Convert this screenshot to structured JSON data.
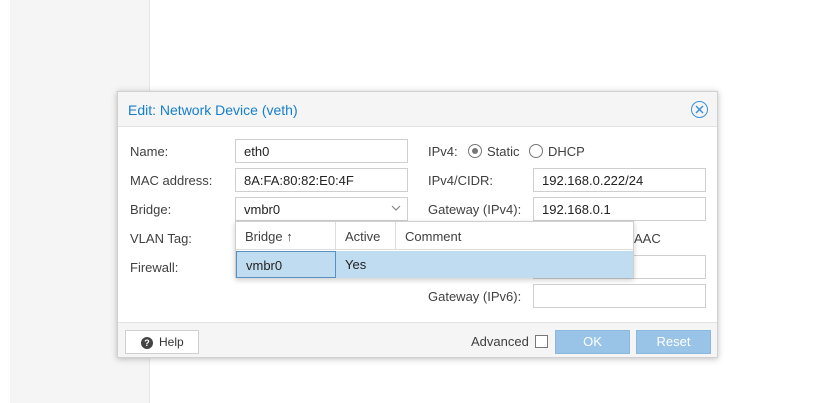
{
  "dialog": {
    "title": "Edit: Network Device (veth)",
    "close_icon": "close-circle-icon"
  },
  "form": {
    "name_label": "Name:",
    "name_value": "eth0",
    "mac_label": "MAC address:",
    "mac_value": "8A:FA:80:82:E0:4F",
    "bridge_label": "Bridge:",
    "bridge_value": "vmbr0",
    "vlan_label": "VLAN Tag:",
    "firewall_label": "Firewall:",
    "ipv4_label": "IPv4:",
    "ipv4_static_label": "Static",
    "ipv4_dhcp_label": "DHCP",
    "ipv4_selected": "Static",
    "ipv4cidr_label": "IPv4/CIDR:",
    "ipv4cidr_value": "192.168.0.222/24",
    "gateway4_label": "Gateway (IPv4):",
    "gateway4_value": "192.168.0.1",
    "ipv6_partial_label": "AAC",
    "ipv6cidr_value": "",
    "gateway6_label": "Gateway (IPv6):",
    "gateway6_value": ""
  },
  "bridge_dropdown": {
    "columns": [
      "Bridge ↑",
      "Active",
      "Comment"
    ],
    "rows": [
      {
        "bridge": "vmbr0",
        "active": "Yes",
        "comment": ""
      }
    ]
  },
  "footer": {
    "help_label": "Help",
    "advanced_label": "Advanced",
    "ok_label": "OK",
    "reset_label": "Reset"
  },
  "colors": {
    "accent": "#157fcc",
    "button_disabled": "#99c4e8",
    "selected_row": "#c0dcf0"
  }
}
